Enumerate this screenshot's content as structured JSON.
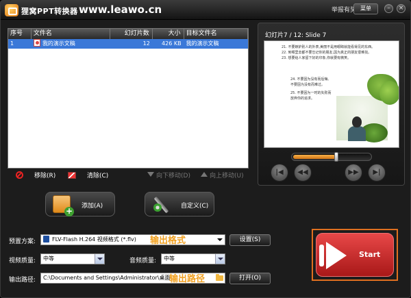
{
  "titlebar": {
    "app_title": "狸窝PPT转换器",
    "url": "www.leawo.cn",
    "report": "举报有奖",
    "menu": "菜单",
    "minimize": "–",
    "close": "×"
  },
  "file_list": {
    "columns": [
      "序号",
      "文件名",
      "幻灯片数",
      "大小",
      "目标文件名"
    ],
    "rows": [
      {
        "no": "1",
        "name": "我的演示文稿",
        "slides": "12",
        "size": "426 KB",
        "target": "我的演示文稿"
      }
    ]
  },
  "list_actions": {
    "remove": "移除(R)",
    "clear": "清除(C)",
    "move_down": "向下移动(D)",
    "move_up": "向上移动(U)"
  },
  "preview": {
    "caption": "幻灯片7 / 12: Slide 7",
    "progress": 0.55,
    "slide_lines_top": [
      "21. 不要嫉妒别人的外表,美丽不是用眼睛就能看得见的东西。",
      "22. 到哪里去都不要忘记你的朋友,因为真正的朋友很难找。",
      "23. 想要给人家留下好的印象,你就要有微笑。"
    ],
    "slide_lines_left": [
      "24. 不要因为没有而后悔,不要因为没有而难过。",
      "25. 不要因为一时的失败而放弃你的追求。"
    ]
  },
  "buttons": {
    "add": "添加(A)",
    "custom": "自定义(C)",
    "settings": "设置(S)",
    "open": "打开(O)",
    "start": "Start"
  },
  "settings": {
    "preset_label": "预置方案:",
    "preset_value": "FLV-Flash H.264 视频格式 (*.flv)",
    "preset_note": "输出格式",
    "video_quality_label": "视频质量:",
    "video_quality_value": "中等",
    "audio_quality_label": "音频质量:",
    "audio_quality_value": "中等",
    "output_label": "输出路径:",
    "output_value": "C:\\Documents and Settings\\Administrator\\桌面",
    "output_note": "输出路径"
  }
}
